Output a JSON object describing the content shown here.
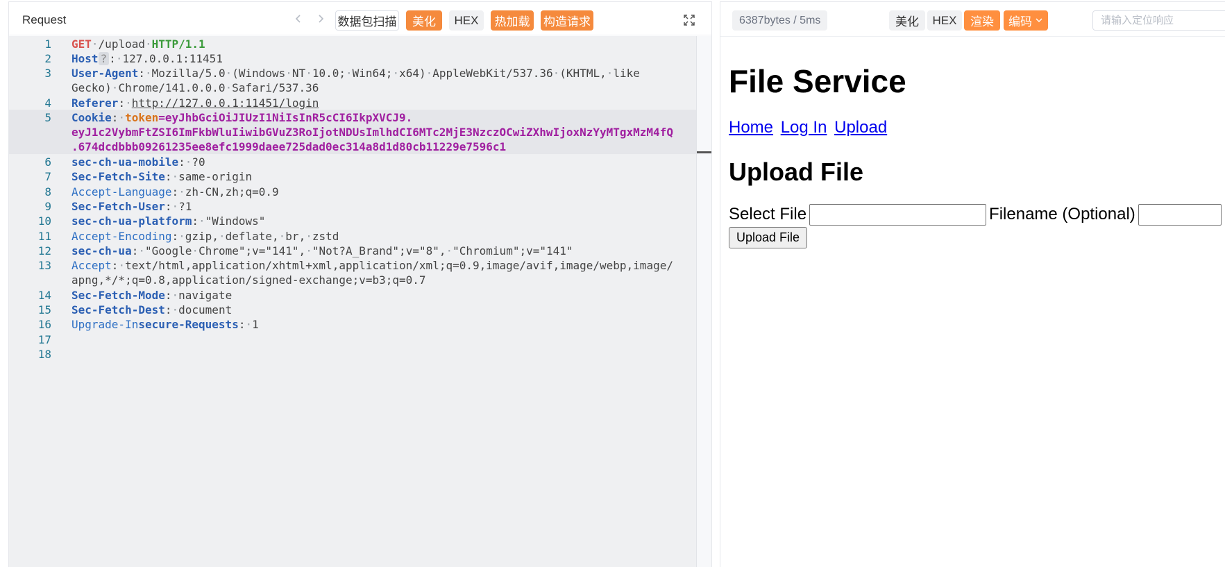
{
  "left": {
    "title": "Request",
    "buttons": {
      "scan": "数据包扫描",
      "beautify": "美化",
      "hex": "HEX",
      "hot_load": "热加载",
      "build_request": "构造请求"
    },
    "lines": [
      {
        "n": "1"
      },
      {
        "n": "2"
      },
      {
        "n": "3"
      },
      {
        "n": ""
      },
      {
        "n": "4"
      },
      {
        "n": "5"
      },
      {
        "n": ""
      },
      {
        "n": ""
      },
      {
        "n": "6"
      },
      {
        "n": "7"
      },
      {
        "n": "8"
      },
      {
        "n": "9"
      },
      {
        "n": "10"
      },
      {
        "n": "11"
      },
      {
        "n": "12"
      },
      {
        "n": "13"
      },
      {
        "n": ""
      },
      {
        "n": "14"
      },
      {
        "n": "15"
      },
      {
        "n": "16"
      },
      {
        "n": "17"
      },
      {
        "n": "18"
      }
    ],
    "code": {
      "l1_method": "GET",
      "l1_path": "/upload",
      "l1_proto": "HTTP/1.1",
      "l2_key": "Host",
      "l2_q": "?",
      "l2_val": "127.0.0.1:11451",
      "l3_key": "User-Agent",
      "l3_val": "Mozilla/5.0 (Windows NT 10.0; Win64; x64) AppleWebKit/537.36 (KHTML, like",
      "l3b_val": "Gecko) Chrome/141.0.0.0 Safari/537.36",
      "l4_key": "Referer",
      "l4_val": "http://127.0.0.1:11451/login",
      "l5_key": "Cookie",
      "l5_cookie_name": "token",
      "l5_val": "eyJhbGciOiJIUzI1NiIsInR5cCI6IkpXVCJ9.",
      "l5b_val": "eyJ1c2VybmFtZSI6ImFkbWluIiwibGVuZ3RoIjotNDUsImlhdCI6MTc2MjE3NzczOCwiZXhwIjoxNzYyMTgxMzM4fQ",
      "l5c_val": ".674dcdbbb09261235ee8efc1999daee725dad0ec314a8d1d80cb11229e7596c1",
      "l6_key": "sec-ch-ua-mobile",
      "l6_val": "?0",
      "l7_key": "Sec-Fetch-Site",
      "l7_val": "same-origin",
      "l8_key": "Accept-Language",
      "l8_val": "zh-CN,zh;q=0.9",
      "l9_key": "Sec-Fetch-User",
      "l9_val": "?1",
      "l10_key": "sec-ch-ua-platform",
      "l10_val": "\"Windows\"",
      "l11_key": "Accept-Encoding",
      "l11_val": "gzip, deflate, br, zstd",
      "l12_key": "sec-ch-ua",
      "l12_val": "\"Google Chrome\";v=\"141\", \"Not?A_Brand\";v=\"8\", \"Chromium\";v=\"141\"",
      "l13_key": "Accept",
      "l13_val": "text/html,application/xhtml+xml,application/xml;q=0.9,image/avif,image/webp,image/",
      "l13b_val": "apng,*/*;q=0.8,application/signed-exchange;v=b3;q=0.7",
      "l14_key": "Sec-Fetch-Mode",
      "l14_val": "navigate",
      "l15_key": "Sec-Fetch-Dest",
      "l15_val": "document",
      "l16_key_a": "Upgrade-In",
      "l16_key_b": "secure-Requests",
      "l16_val": "1"
    }
  },
  "right": {
    "info": "6387bytes / 5ms",
    "buttons": {
      "beautify": "美化",
      "hex": "HEX",
      "render": "渲染",
      "encoding": "编码"
    },
    "locate_placeholder": "请输入定位响应",
    "page": {
      "title": "File Service",
      "nav": [
        "Home",
        "Log In",
        "Upload"
      ],
      "heading": "Upload File",
      "select_label": "Select File",
      "filename_label": "Filename (Optional)",
      "upload_button": "Upload File"
    }
  },
  "colors": {
    "accent_orange": "#f58a3d",
    "editor_bg": "#eff0f2",
    "line_number": "#237893",
    "header_key": "#2b5fb3"
  }
}
